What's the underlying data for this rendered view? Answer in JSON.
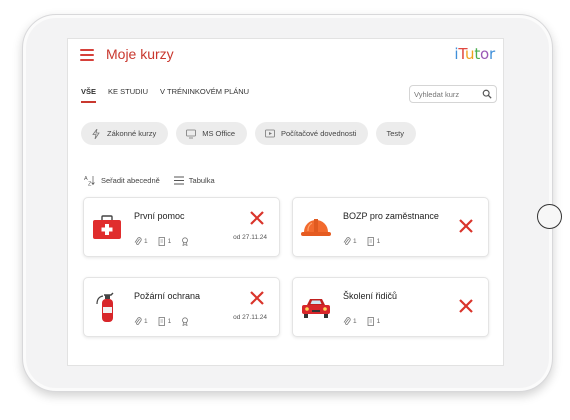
{
  "app": {
    "title": "Moje kurzy",
    "logo": [
      "i",
      "T",
      "u",
      "t",
      "o",
      "r"
    ],
    "logo_colors": [
      "#3f8fd9",
      "#e04840",
      "#f0a21e",
      "#4caf50",
      "#9b59b6",
      "#3f8fd9"
    ]
  },
  "tabs": [
    {
      "label": "VŠE",
      "active": true
    },
    {
      "label": "KE STUDIU",
      "active": false
    },
    {
      "label": "V TRÉNINKOVÉM PLÁNU",
      "active": false
    }
  ],
  "search": {
    "placeholder": "Vyhledat kurz",
    "icon": "search-icon"
  },
  "chips": [
    {
      "label": "Zákonné kurzy",
      "icon": "lightning-icon"
    },
    {
      "label": "MS Office",
      "icon": "monitor-icon"
    },
    {
      "label": "Počítačové dovednosti",
      "icon": "play-icon"
    },
    {
      "label": "Testy",
      "icon": ""
    }
  ],
  "tools": {
    "sort_label": "Seřadit abecedně",
    "view_label": "Tabulka"
  },
  "courses": [
    {
      "title": "První pomoc",
      "icon": "first-aid-kit-icon",
      "lessons": "1",
      "tests": "1",
      "has_certificate": true,
      "date": "od 27.11.24"
    },
    {
      "title": "BOZP pro zaměstnance",
      "icon": "hard-hat-icon",
      "lessons": "1",
      "tests": "1",
      "has_certificate": false,
      "date": ""
    },
    {
      "title": "Požární ochrana",
      "icon": "fire-extinguisher-icon",
      "lessons": "1",
      "tests": "1",
      "has_certificate": true,
      "date": "od 27.11.24"
    },
    {
      "title": "Školení řidičů",
      "icon": "car-icon",
      "lessons": "1",
      "tests": "1",
      "has_certificate": false,
      "date": ""
    }
  ],
  "colors": {
    "accent": "#c9382f",
    "remove": "#d9342b"
  }
}
